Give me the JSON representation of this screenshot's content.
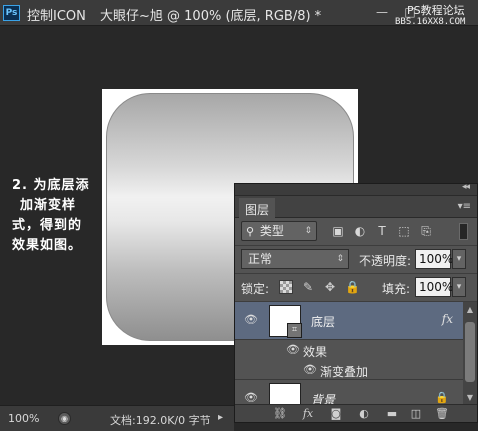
{
  "window": {
    "app_badge": "Ps",
    "app_title": "控制ICON",
    "document_title": "大眼仔~旭 @ 100% (底层, RGB/8) *",
    "minimize_glyph": "—",
    "restore_glyph": "□",
    "watermark_line1": "PS教程论坛",
    "watermark_line2": "BBS.16XX8.COM"
  },
  "instruction": {
    "lines": [
      "2. 为底层添",
      "加渐变样",
      "式，得到的",
      "效果如图。"
    ]
  },
  "layers_panel": {
    "collapse_glyph": "◂◂",
    "tab_label": "图层",
    "menu_glyph": "▾≡",
    "filter": {
      "kind_label": "类型",
      "search_glyph": "⚲",
      "caret": "⇕",
      "icons": [
        "image-filter-icon",
        "adjustment-filter-icon",
        "type-filter-icon",
        "shape-filter-icon",
        "smart-object-filter-icon"
      ],
      "icon_glyphs": [
        "▣",
        "◐",
        "T",
        "⬚",
        "⎘"
      ]
    },
    "blend_mode": "正常",
    "blend_caret": "⇕",
    "opacity_label": "不透明度:",
    "opacity_value": "100%",
    "dropdown_glyph": "▾",
    "lock_label": "锁定:",
    "lock_glyphs": [
      "",
      "✎",
      "✥",
      "🔒"
    ],
    "fill_label": "填充:",
    "fill_value": "100%",
    "layers": [
      {
        "name": "底层",
        "selected": true,
        "fx": "fx",
        "effects_label": "效果",
        "effect_items": [
          "渐变叠加"
        ]
      },
      {
        "name": "背景",
        "locked": true
      }
    ],
    "eye_glyph": "👁",
    "lock_glyph": "🔒",
    "thumb_badge_glyph": "⌗",
    "scroll_up_glyph": "▲",
    "scroll_down_glyph": "▼",
    "footer_icons": [
      "link-icon",
      "fx-icon",
      "mask-icon",
      "adjustment-icon",
      "group-folder-icon",
      "new-layer-icon",
      "trash-icon"
    ],
    "footer_glyphs": [
      "⛓",
      "fx",
      "◙",
      "◐",
      "▬",
      "◫",
      "🗑"
    ]
  },
  "status": {
    "zoom": "100%",
    "status_button_glyph": "◉",
    "doc_info": "文档:192.0K/0 字节",
    "arrow": "▸"
  },
  "colors": {
    "workspace_bg": "#282828",
    "panel_bg": "#535353",
    "selected_layer_bg": "#5d6a80",
    "canvas_bg": "#ffffff"
  }
}
